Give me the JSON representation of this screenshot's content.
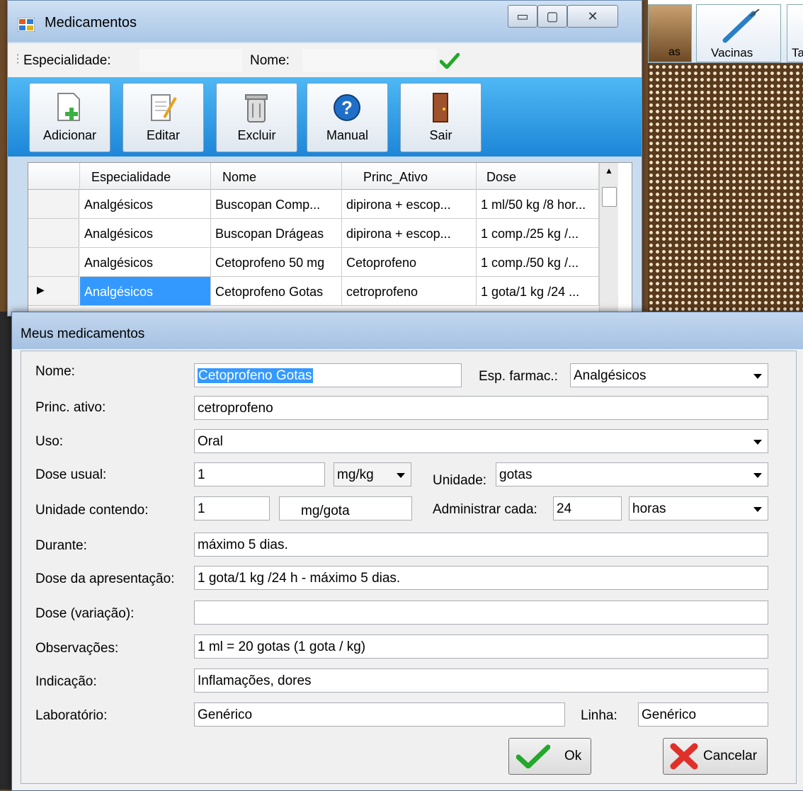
{
  "main_window": {
    "title": "Medicamentos",
    "filter": {
      "especialidade_label": "Especialidade:",
      "nome_label": "Nome:"
    },
    "toolbar": [
      {
        "id": "add",
        "label": "Adicionar",
        "icon": "document-add-icon"
      },
      {
        "id": "edit",
        "label": "Editar",
        "icon": "notepad-edit-icon"
      },
      {
        "id": "delete",
        "label": "Excluir",
        "icon": "trash-can-icon"
      },
      {
        "id": "manual",
        "label": "Manual",
        "icon": "help-icon"
      },
      {
        "id": "exit",
        "label": "Sair",
        "icon": "door-exit-icon"
      }
    ],
    "grid": {
      "columns": [
        "Especialidade",
        "Nome",
        "Princ_Ativo",
        "Dose"
      ],
      "rows": [
        [
          "Analgésicos",
          "Buscopan Comp...",
          "dipirona + escop...",
          "1 ml/50 kg /8 hor..."
        ],
        [
          "Analgésicos",
          "Buscopan Drágeas",
          "dipirona + escop...",
          "1 comp./25 kg /..."
        ],
        [
          "Analgésicos",
          "Cetoprofeno 50 mg",
          "Cetoprofeno",
          "1 comp./50 kg /..."
        ],
        [
          "Analgésicos",
          "Cetoprofeno Gotas",
          "cetroprofeno",
          "1 gota/1 kg /24 ..."
        ]
      ]
    }
  },
  "background_toolbar": {
    "vacinas": "Vacinas",
    "partial_left": "as",
    "partial_right": "Ta"
  },
  "dialog": {
    "title": "Meus medicamentos",
    "fields": {
      "nome": {
        "label": "Nome:",
        "value": "Cetoprofeno Gotas"
      },
      "esp_farmac": {
        "label": "Esp. farmac.:",
        "value": "Analgésicos"
      },
      "princ_ativo": {
        "label": "Princ. ativo:",
        "value": "cetroprofeno"
      },
      "uso": {
        "label": "Uso:",
        "value": "Oral"
      },
      "dose_usual": {
        "label": "Dose usual:",
        "value": "1",
        "unit": "mg/kg"
      },
      "unidade": {
        "label": "Unidade:",
        "value": "gotas"
      },
      "unidade_contendo": {
        "label": "Unidade contendo:",
        "value": "1",
        "unit": "mg/gota"
      },
      "administrar_cada": {
        "label": "Administrar cada:",
        "value": "24",
        "unit": "horas"
      },
      "durante": {
        "label": "Durante:",
        "value": "máximo 5 dias."
      },
      "dose_apresentacao": {
        "label": "Dose da apresentação:",
        "value": "1 gota/1 kg /24 h - máximo 5 dias."
      },
      "dose_variacao": {
        "label": "Dose (variação):",
        "value": ""
      },
      "observacoes": {
        "label": "Observações:",
        "value": "1 ml = 20 gotas (1 gota / kg)"
      },
      "indicacao": {
        "label": "Indicação:",
        "value": "Inflamações, dores"
      },
      "laboratorio": {
        "label": "Laboratório:",
        "value": "Genérico"
      },
      "linha": {
        "label": "Linha:",
        "value": "Genérico"
      }
    },
    "buttons": {
      "ok": "Ok",
      "cancel": "Cancelar"
    }
  }
}
